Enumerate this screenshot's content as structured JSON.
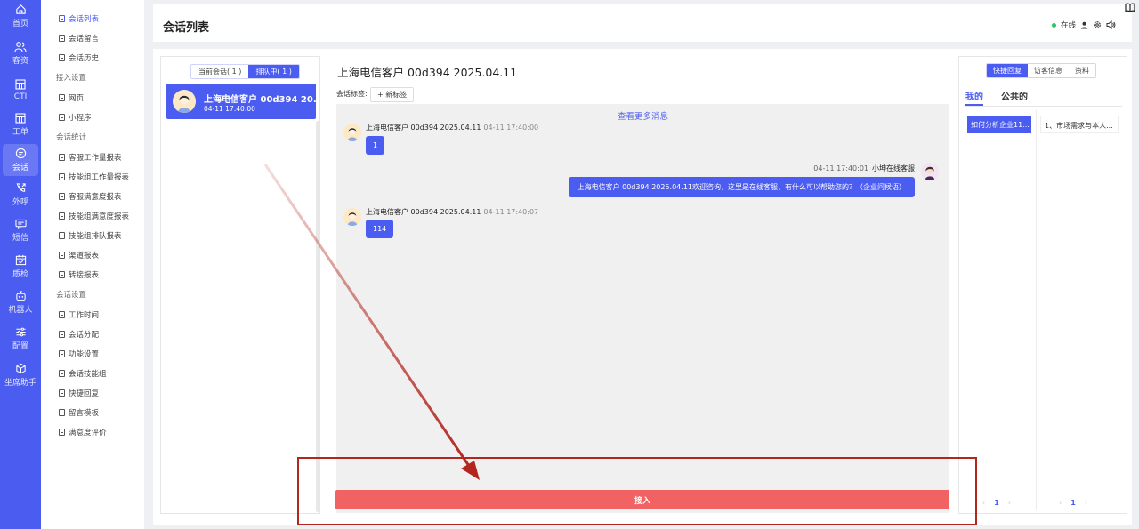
{
  "rail": [
    {
      "label": "首页",
      "icon": "home-icon"
    },
    {
      "label": "客资",
      "icon": "users-icon"
    },
    {
      "label": "CTI",
      "icon": "grid-icon"
    },
    {
      "label": "工单",
      "icon": "grid-icon"
    },
    {
      "label": "会话",
      "icon": "chat-icon",
      "active": true
    },
    {
      "label": "外呼",
      "icon": "phone-out-icon"
    },
    {
      "label": "短信",
      "icon": "sms-icon"
    },
    {
      "label": "质检",
      "icon": "calendar-check-icon"
    },
    {
      "label": "机器人",
      "icon": "robot-icon"
    },
    {
      "label": "配置",
      "icon": "sliders-icon"
    },
    {
      "label": "坐席助手",
      "icon": "cube-icon"
    }
  ],
  "subnav": {
    "items_top": [
      "会话列表",
      "会话留言",
      "会话历史"
    ],
    "group_access": "接入设置",
    "items_access": [
      "网页",
      "小程序"
    ],
    "group_stats": "会话统计",
    "items_stats": [
      "客服工作量报表",
      "技能组工作量报表",
      "客服满意度报表",
      "技能组满意度报表",
      "技能组排队报表",
      "渠道报表",
      "转接报表"
    ],
    "group_settings": "会话设置",
    "items_settings": [
      "工作时间",
      "会话分配",
      "功能设置",
      "会话技能组",
      "快捷回复",
      "留言模板",
      "满意度评价"
    ]
  },
  "header": {
    "title": "会话列表",
    "status": "在线"
  },
  "left_panel": {
    "tab_current": "当前会话( 1 )",
    "tab_queue": "排队中( 1 )",
    "conversation": {
      "name": "上海电信客户 00d394 20...",
      "time": "04-11 17:40:00"
    }
  },
  "chat": {
    "title": "上海电信客户 00d394 2025.04.11",
    "tags_label": "会话标签:",
    "add_tag": "+ 新标签",
    "load_more": "查看更多消息",
    "messages": [
      {
        "sender": "上海电信客户 00d394 2025.04.11",
        "time": "04-11 17:40:00",
        "text": "1"
      },
      {
        "sender": "小坤在线客服",
        "time": "04-11 17:40:01",
        "text": "上海电信客户 00d394 2025.04.11欢迎咨询，这里是在线客服，有什么可以帮助您的？（企业问候语）"
      },
      {
        "sender": "上海电信客户 00d394 2025.04.11",
        "time": "04-11 17:40:07",
        "text": "114"
      }
    ],
    "accept_button": "接入"
  },
  "right_panel": {
    "tabs": [
      "快捷回复",
      "访客信息",
      "资料"
    ],
    "subtabs": [
      "我的",
      "公共的"
    ],
    "selected_group": "如何分析企业11...",
    "reply_item": "1、市场需求与本人...",
    "page_left": "1",
    "page_right": "1"
  },
  "colors": {
    "primary": "#4b5cf0",
    "accept": "#f06362",
    "annotation": "#b3261e",
    "online": "#2ec36a"
  }
}
